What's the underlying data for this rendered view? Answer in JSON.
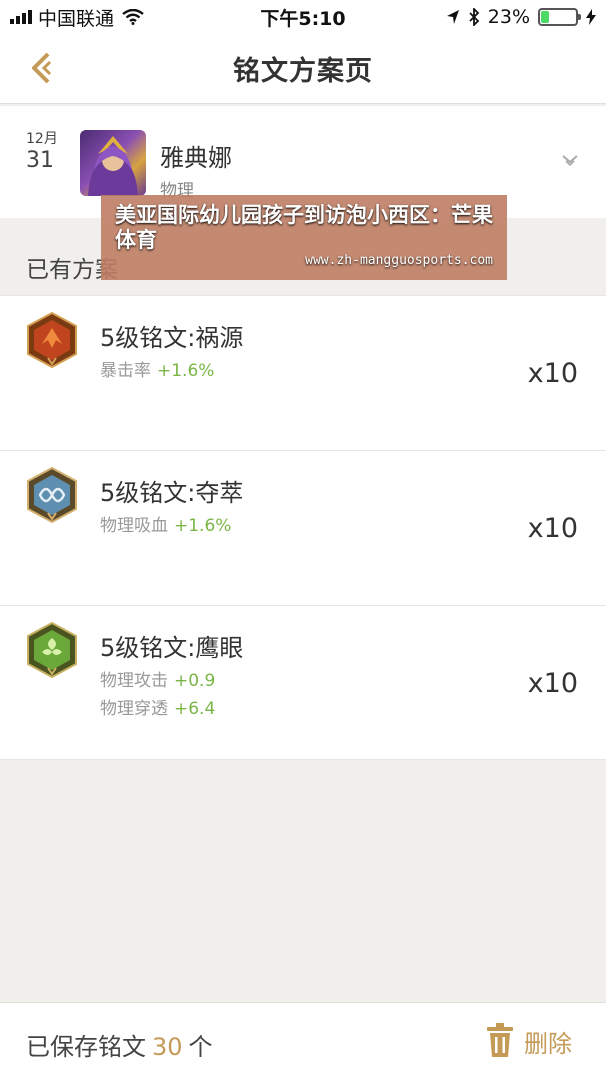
{
  "status_bar": {
    "carrier": "中国联通",
    "time": "下午5:10",
    "battery_percent": "23%",
    "battery_level": 0.23
  },
  "nav": {
    "title": "铭文方案页",
    "back_icon": "back-chevron-icon"
  },
  "hero": {
    "month": "12月",
    "day": "31",
    "name": "雅典娜",
    "type": "物理"
  },
  "section_label": "已有方案",
  "inscriptions": [
    {
      "name": "5级铭文:祸源",
      "icon": "red-emblem-icon",
      "stats": [
        {
          "label": "暴击率",
          "value": "+1.6%"
        }
      ],
      "count": "x10"
    },
    {
      "name": "5级铭文:夺萃",
      "icon": "blue-emblem-icon",
      "stats": [
        {
          "label": "物理吸血",
          "value": "+1.6%"
        }
      ],
      "count": "x10"
    },
    {
      "name": "5级铭文:鹰眼",
      "icon": "green-emblem-icon",
      "stats": [
        {
          "label": "物理攻击",
          "value": "+0.9"
        },
        {
          "label": "物理穿透",
          "value": "+6.4"
        }
      ],
      "count": "x10"
    }
  ],
  "footer": {
    "saved_prefix": "已保存铭文",
    "saved_count": "30",
    "saved_suffix": "个",
    "delete_label": "删除"
  },
  "overlay": {
    "headline": "美亚国际幼儿园孩子到访泡小西区：芒果体育",
    "url": "www.zh-mangguosports.com"
  },
  "colors": {
    "accent": "#c49a56",
    "stat_value": "#7ab646",
    "red_emblem": "#c0451f",
    "blue_emblem": "#5f8fb0",
    "green_emblem": "#6aa83a"
  }
}
